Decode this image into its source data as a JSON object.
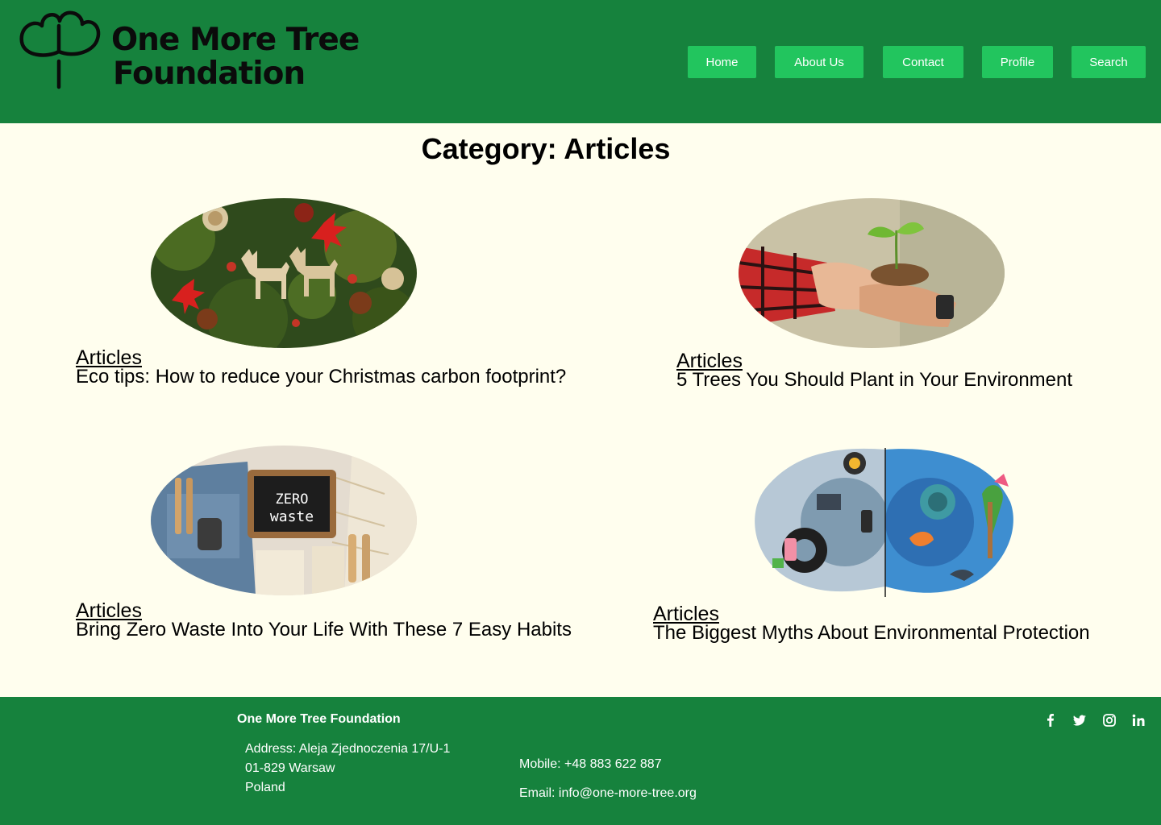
{
  "brand": {
    "line1": "One More Tree",
    "line2": "Foundation",
    "icon": "tree-logo-icon"
  },
  "nav": [
    {
      "label": "Home"
    },
    {
      "label": "About Us"
    },
    {
      "label": "Contact"
    },
    {
      "label": "Profile"
    },
    {
      "label": "Search"
    }
  ],
  "page": {
    "title": "Category: Articles"
  },
  "articles": [
    {
      "category": "Articles",
      "title": "Eco tips: How to reduce your Christmas carbon footprint?",
      "image": "christmas-reindeer-moss-image"
    },
    {
      "category": "Articles",
      "title": "5 Trees You Should Plant in Your Environment",
      "image": "hands-holding-seedling-image"
    },
    {
      "category": "Articles",
      "title": "Bring Zero Waste Into Your Life With These 7 Easy Habits",
      "image": "zero-waste-chalkboard-image",
      "chalk_line1": "ZERO",
      "chalk_line2": "waste"
    },
    {
      "category": "Articles",
      "title": "The Biggest Myths About Environmental Protection",
      "image": "polluted-vs-clean-planet-image"
    }
  ],
  "footer": {
    "org": "One More Tree Foundation",
    "address": [
      "Address: Aleja Zjednoczenia 17/U-1",
      "01-829 Warsaw",
      "Poland"
    ],
    "mobile": "Mobile: +48 883 622 887",
    "email": "Email: info@one-more-tree.org",
    "social": [
      "facebook-icon",
      "twitter-icon",
      "instagram-icon",
      "linkedin-icon"
    ]
  },
  "colors": {
    "header_bg": "#16823d",
    "nav_button": "#22c55e",
    "page_bg": "#fffeee",
    "footer_bg": "#16823d"
  }
}
